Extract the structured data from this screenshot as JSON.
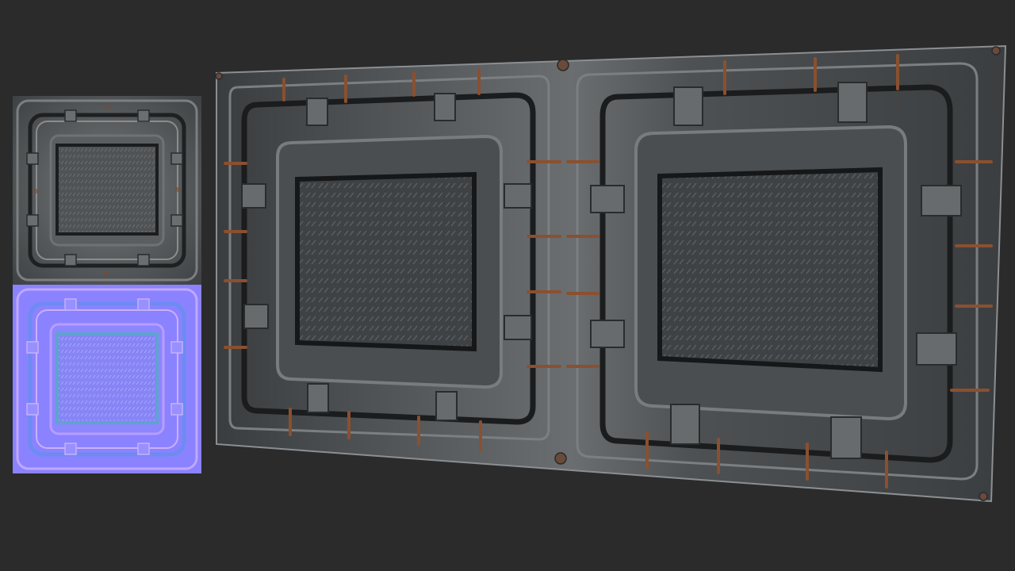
{
  "scene": {
    "background_color": "#2b2b2b",
    "description_visible_text": ""
  },
  "diffuse_map": {
    "label": "",
    "base_color": "#5a5d5f",
    "rust_color": "#7a4a30",
    "grate_color": "#4a4c4e"
  },
  "normal_map": {
    "label": "",
    "base_color": "#8080ff",
    "edge_color_a": "#b9a5ff",
    "edge_color_b": "#6c8cff"
  },
  "material_preview": {
    "panel_count": 2,
    "metal_color": "#55585a",
    "rust_color": "#8a5030",
    "grate_color": "#3e4042"
  }
}
